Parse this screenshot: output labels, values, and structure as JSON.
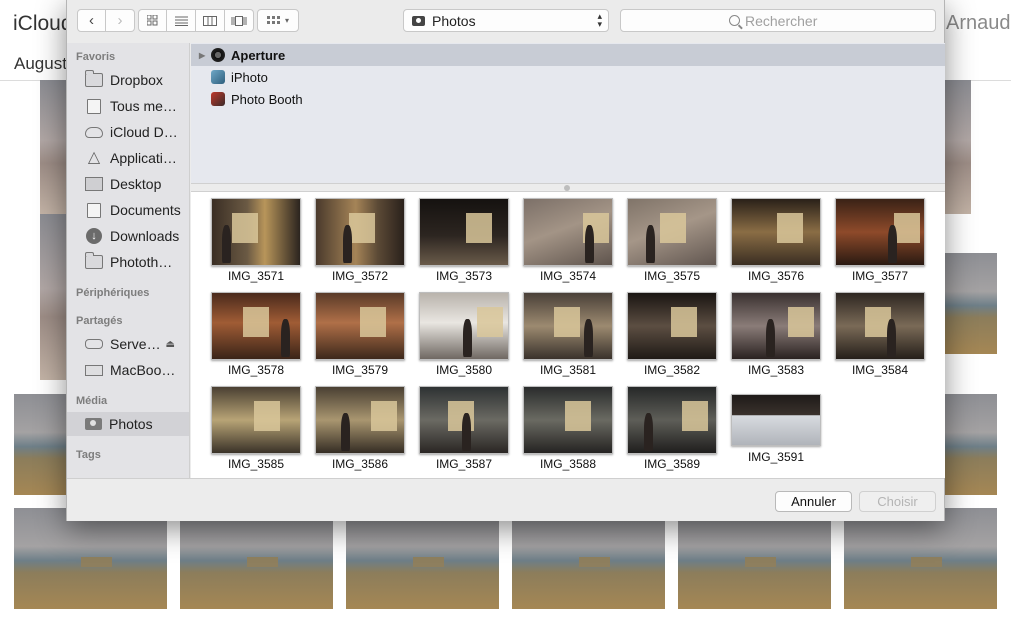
{
  "background": {
    "app_title": "iCloud",
    "user_name": "Arnaud",
    "section_title": "August"
  },
  "toolbar": {
    "back_icon": "chevron-left-icon",
    "forward_icon": "chevron-right-icon",
    "view_modes": [
      "icon-view-icon",
      "list-view-icon",
      "column-view-icon",
      "coverflow-view-icon"
    ],
    "arrange_icon": "arrange-grid-icon",
    "location_label": "Photos",
    "search_placeholder": "Rechercher"
  },
  "sidebar": {
    "favorites_header": "Favoris",
    "favorites": [
      {
        "label": "Dropbox",
        "icon": "folder-icon"
      },
      {
        "label": "Tous me…",
        "icon": "document-icon"
      },
      {
        "label": "iCloud D…",
        "icon": "cloud-icon"
      },
      {
        "label": "Applicati…",
        "icon": "applications-icon"
      },
      {
        "label": "Desktop",
        "icon": "desktop-icon"
      },
      {
        "label": "Documents",
        "icon": "document-icon"
      },
      {
        "label": "Downloads",
        "icon": "download-icon"
      },
      {
        "label": "Phototh…",
        "icon": "folder-icon"
      }
    ],
    "devices_header": "Périphériques",
    "shared_header": "Partagés",
    "shared": [
      {
        "label": "Serve…",
        "icon": "server-icon"
      },
      {
        "label": "MacBoo…",
        "icon": "laptop-icon"
      }
    ],
    "media_header": "Média",
    "media": [
      {
        "label": "Photos",
        "icon": "camera-icon",
        "selected": true
      }
    ],
    "tags_header": "Tags"
  },
  "sources": [
    {
      "label": "Aperture",
      "icon": "aperture-icon",
      "selected": true
    },
    {
      "label": "iPhoto",
      "icon": "iphoto-icon",
      "selected": false
    },
    {
      "label": "Photo Booth",
      "icon": "photo-booth-icon",
      "selected": false
    }
  ],
  "photos": [
    {
      "name": "IMG_3571"
    },
    {
      "name": "IMG_3572"
    },
    {
      "name": "IMG_3573"
    },
    {
      "name": "IMG_3574"
    },
    {
      "name": "IMG_3575"
    },
    {
      "name": "IMG_3576"
    },
    {
      "name": "IMG_3577"
    },
    {
      "name": "IMG_3578"
    },
    {
      "name": "IMG_3579"
    },
    {
      "name": "IMG_3580"
    },
    {
      "name": "IMG_3581"
    },
    {
      "name": "IMG_3582"
    },
    {
      "name": "IMG_3583"
    },
    {
      "name": "IMG_3584"
    },
    {
      "name": "IMG_3585"
    },
    {
      "name": "IMG_3586"
    },
    {
      "name": "IMG_3587"
    },
    {
      "name": "IMG_3588"
    },
    {
      "name": "IMG_3589"
    },
    {
      "name": "IMG_3591"
    }
  ],
  "footer": {
    "cancel_label": "Annuler",
    "choose_label": "Choisir"
  }
}
